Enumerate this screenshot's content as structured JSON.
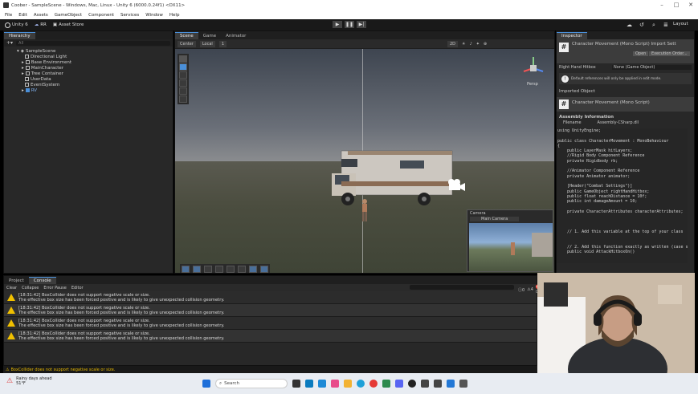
{
  "window": {
    "title": "Coober - SampleScene - Windows, Mac, Linux - Unity 6 (6000.0.24f1) <DX11>"
  },
  "menu": [
    "File",
    "Edit",
    "Assets",
    "GameObject",
    "Component",
    "Services",
    "Window",
    "Help"
  ],
  "toolbar": {
    "account": "Unity 6",
    "collab": "RR",
    "asset_store": "Asset Store",
    "layout": "Layout"
  },
  "hierarchy": {
    "tab": "Hierarchy",
    "search_placeholder": "All",
    "scene": "SampleScene",
    "items": [
      "Directional Light",
      "Base Environment",
      "MainCharacter",
      "Tree Container",
      "UserData",
      "EventSystem",
      "RV"
    ]
  },
  "scene": {
    "tabs": [
      "Scene",
      "Game",
      "Animator"
    ],
    "pivot": "Center",
    "space": "Local",
    "grid_value": "1",
    "mode_2d": "2D",
    "persp_label": "Persp"
  },
  "camera_preview": {
    "title": "Camera",
    "dropdown": "Main Camera"
  },
  "inspector": {
    "tab": "Inspector",
    "script_title": "Character Movement (Mono Script) Import Sett",
    "open_button": "Open",
    "exec_order_button": "Execution Order...",
    "field_label": "Right Hand Hitbox",
    "field_value": "None (Game Object)",
    "info_text": "Default references will only be applied in edit mode.",
    "imported_object": "Imported Object",
    "script_name": "Character Movement (Mono Script)",
    "assembly_title": "Assembly Information",
    "filename_label": "Filename",
    "filename_value": "Assembly-CSharp.dll",
    "code_lines": [
      "using UnityEngine;",
      "",
      "public class CharacterMovement : MonoBehaviour",
      "{",
      "    public LayerMask hitLayers;",
      "    //Rigid Body Component Reference",
      "    private Rigidbody rb;",
      "",
      "    //Animator Component Reference",
      "    private Animator animator;",
      "",
      "    [Header(\"Combat Settings\")]",
      "    public GameObject rightHandHitbox;",
      "    public float reachDistance = 10f;",
      "    public int damageAmount = 10;",
      "",
      "    private CharacterAttributes characterAttributes;",
      "",
      "",
      "",
      "    // 1. Add this variable at the top of your class",
      "",
      "",
      "    // 2. Add this function exactly as written (case sensitive)",
      "    public void AttackHitboxOn()"
    ]
  },
  "bottom": {
    "tabs": [
      "Project",
      "Console"
    ],
    "console_buttons": [
      "Clear",
      "Collapse",
      "Error Pause",
      "Editor"
    ],
    "counts": [
      "0",
      "4",
      "0"
    ],
    "logs": [
      {
        "line1": "[18:31:42] BoxCollider does not support negative scale or size.",
        "line2": "The effective box size has been forced positive and is likely to give unexpected collision geometry."
      },
      {
        "line1": "[18:31:42] BoxCollider does not support negative scale or size.",
        "line2": "The effective box size has been forced positive and is likely to give unexpected collision geometry."
      },
      {
        "line1": "[18:31:42] BoxCollider does not support negative scale or size.",
        "line2": "The effective box size has been forced positive and is likely to give unexpected collision geometry."
      },
      {
        "line1": "[18:31:42] BoxCollider does not support negative scale or size.",
        "line2": "The effective box size has been forced positive and is likely to give unexpected collision geometry."
      }
    ],
    "status": "BoxCollider does not support negative scale or size."
  },
  "taskbar": {
    "weather_line1": "Rainy days ahead",
    "weather_line2": "51°F",
    "search_placeholder": "Search"
  },
  "colors": {
    "accent": "#4a8fd8",
    "warning": "#f0c000",
    "panel_bg": "#282828"
  }
}
